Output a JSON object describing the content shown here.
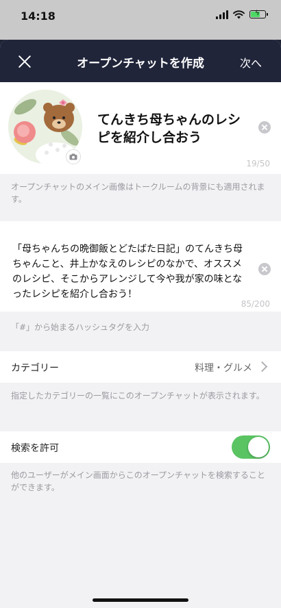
{
  "status": {
    "time": "14:18"
  },
  "nav": {
    "title": "オープンチャットを作成",
    "next_label": "次へ"
  },
  "profile": {
    "room_name": "てんきち母ちゃんのレシピを紹介し合おう",
    "name_counter": "19/50"
  },
  "notes": {
    "image_note": "オープンチャットのメイン画像はトークルームの背景にも適用されます。",
    "hashtag_placeholder": "「#」から始まるハッシュタグを入力",
    "category_note": "指定したカテゴリーの一覧にこのオープンチャットが表示されます。",
    "search_note": "他のユーザーがメイン画面からこのオープンチャットを検索することができます。"
  },
  "description": {
    "text": "「母ちゃんちの晩御飯とどたばた日記」のてんきち母ちゃんこと、井上かなえのレシピのなかで、オススメのレシピ、そこからアレンジして今や我が家の味となったレシピを紹介し合おう！",
    "counter": "85/200"
  },
  "category": {
    "label": "カテゴリー",
    "value": "料理・グルメ"
  },
  "search": {
    "label": "検索を許可",
    "enabled": true
  },
  "colors": {
    "header": "#20253a",
    "toggle_on": "#5ac463",
    "background": "#f2f2f4"
  }
}
